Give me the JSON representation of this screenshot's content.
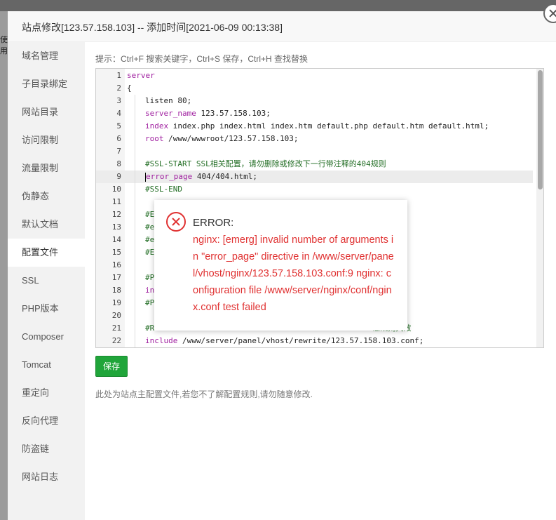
{
  "background": {
    "fragment_text": "使用"
  },
  "dialog": {
    "title": "站点修改[123.57.158.103] -- 添加时间[2021-06-09 00:13:38]"
  },
  "sidebar": {
    "items": [
      {
        "label": "域名管理",
        "active": false
      },
      {
        "label": "子目录绑定",
        "active": false
      },
      {
        "label": "网站目录",
        "active": false
      },
      {
        "label": "访问限制",
        "active": false
      },
      {
        "label": "流量限制",
        "active": false
      },
      {
        "label": "伪静态",
        "active": false
      },
      {
        "label": "默认文档",
        "active": false
      },
      {
        "label": "配置文件",
        "active": true
      },
      {
        "label": "SSL",
        "active": false
      },
      {
        "label": "PHP版本",
        "active": false
      },
      {
        "label": "Composer",
        "active": false
      },
      {
        "label": "Tomcat",
        "active": false
      },
      {
        "label": "重定向",
        "active": false
      },
      {
        "label": "反向代理",
        "active": false
      },
      {
        "label": "防盗链",
        "active": false
      },
      {
        "label": "网站日志",
        "active": false
      }
    ]
  },
  "main": {
    "hint": "提示：Ctrl+F 搜索关键字，Ctrl+S 保存，Ctrl+H 查找替换",
    "save_label": "保存",
    "footnote": "此处为站点主配置文件,若您不了解配置规则,请勿随意修改."
  },
  "editor": {
    "current_line": 9,
    "lines": [
      {
        "n": "1",
        "indent": false,
        "tokens": [
          {
            "t": "server",
            "c": "kw"
          }
        ]
      },
      {
        "n": "2",
        "indent": false,
        "tokens": [
          {
            "t": "{",
            "c": "plain"
          }
        ]
      },
      {
        "n": "3",
        "indent": true,
        "tokens": [
          {
            "t": "listen 80;",
            "c": "plain"
          }
        ]
      },
      {
        "n": "4",
        "indent": true,
        "tokens": [
          {
            "t": "server_name",
            "c": "kw"
          },
          {
            "t": " 123.57.158.103;",
            "c": "plain"
          }
        ]
      },
      {
        "n": "5",
        "indent": true,
        "tokens": [
          {
            "t": "index",
            "c": "kw"
          },
          {
            "t": " index.php index.html index.htm default.php default.htm default.html;",
            "c": "plain"
          }
        ]
      },
      {
        "n": "6",
        "indent": true,
        "tokens": [
          {
            "t": "root",
            "c": "kw"
          },
          {
            "t": " /www/wwwroot/123.57.158.103;",
            "c": "plain"
          }
        ]
      },
      {
        "n": "7",
        "indent": true,
        "tokens": []
      },
      {
        "n": "8",
        "indent": true,
        "tokens": [
          {
            "t": "#SSL-START SSL相关配置，请勿删除或修改下一行带注释的404规则",
            "c": "cmt"
          }
        ]
      },
      {
        "n": "9",
        "indent": true,
        "tokens": [
          {
            "t": "error_page",
            "c": "kw"
          },
          {
            "t": " 404/404.html;",
            "c": "plain"
          }
        ]
      },
      {
        "n": "10",
        "indent": true,
        "tokens": [
          {
            "t": "#SSL-END",
            "c": "cmt"
          }
        ]
      },
      {
        "n": "11",
        "indent": true,
        "tokens": []
      },
      {
        "n": "12",
        "indent": true,
        "tokens": [
          {
            "t": "#E",
            "c": "cmt"
          }
        ]
      },
      {
        "n": "13",
        "indent": true,
        "tokens": [
          {
            "t": "#e",
            "c": "cmt"
          }
        ]
      },
      {
        "n": "14",
        "indent": true,
        "tokens": [
          {
            "t": "#e",
            "c": "cmt"
          }
        ]
      },
      {
        "n": "15",
        "indent": true,
        "tokens": [
          {
            "t": "#E",
            "c": "cmt"
          }
        ]
      },
      {
        "n": "16",
        "indent": true,
        "tokens": []
      },
      {
        "n": "17",
        "indent": true,
        "tokens": [
          {
            "t": "#P",
            "c": "cmt"
          }
        ]
      },
      {
        "n": "18",
        "indent": true,
        "tokens": [
          {
            "t": "in",
            "c": "kw"
          }
        ]
      },
      {
        "n": "19",
        "indent": true,
        "tokens": [
          {
            "t": "#P",
            "c": "cmt"
          }
        ]
      },
      {
        "n": "20",
        "indent": true,
        "tokens": []
      },
      {
        "n": "21",
        "indent": true,
        "tokens": [
          {
            "t": "#R                                               态规则失效",
            "c": "cmt"
          }
        ]
      },
      {
        "n": "22",
        "indent": true,
        "tokens": [
          {
            "t": "include",
            "c": "kw"
          },
          {
            "t": " /www/server/panel/vhost/rewrite/123.57.158.103.conf;",
            "c": "plain"
          }
        ]
      }
    ]
  },
  "error_dialog": {
    "title": "ERROR:",
    "message": "nginx: [emerg] invalid number of arguments in \"error_page\" directive in /www/server/panel/vhost/nginx/123.57.158.103.conf:9 nginx: configuration file /www/server/nginx/conf/nginx.conf test failed",
    "icon": "error-circle-icon",
    "color": "#e03131"
  },
  "colors": {
    "accent": "#20a53a",
    "error": "#e03131",
    "keyword": "#a020a0",
    "comment": "#236e25"
  }
}
